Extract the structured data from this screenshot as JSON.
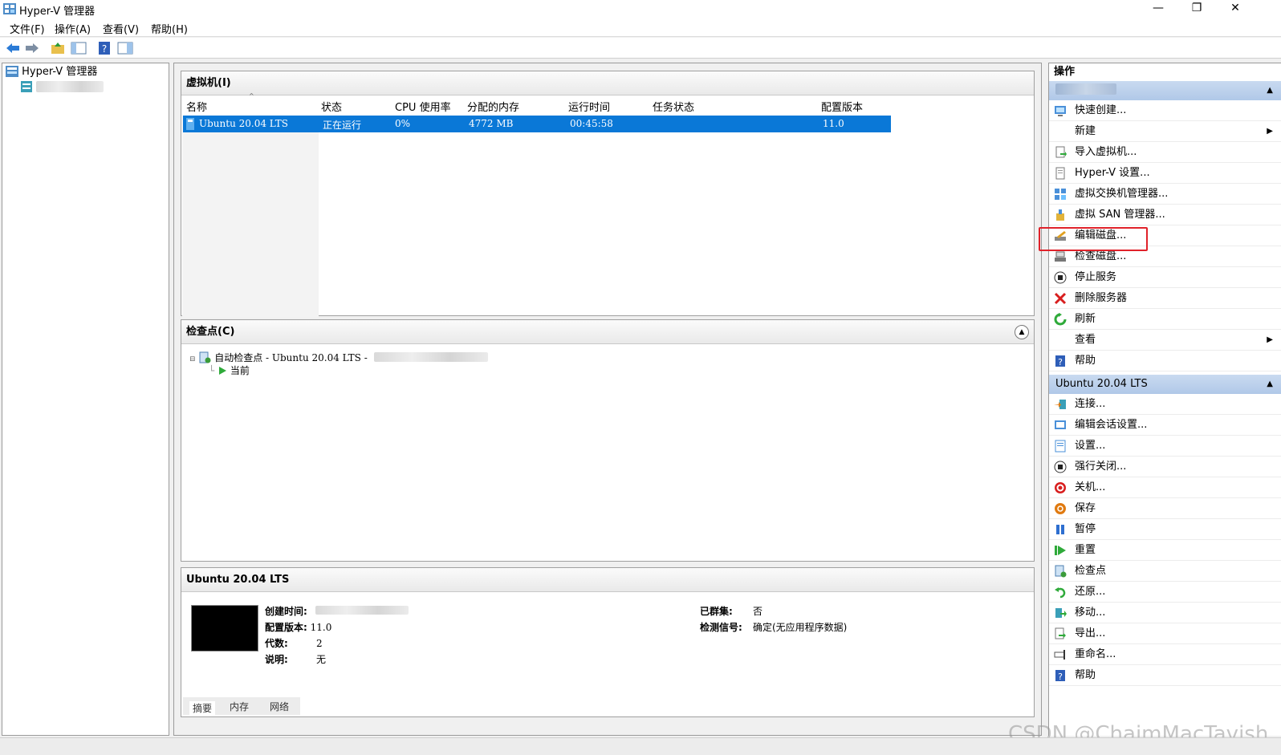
{
  "window": {
    "title": "Hyper-V 管理器",
    "minimize": "—",
    "restore": "❐",
    "close": "✕"
  },
  "menu": [
    "文件(F)",
    "操作(A)",
    "查看(V)",
    "帮助(H)"
  ],
  "tree": {
    "root": "Hyper-V 管理器"
  },
  "vm_panel": {
    "title": "虚拟机(I)",
    "columns": [
      "名称",
      "状态",
      "CPU 使用率",
      "分配的内存",
      "运行时间",
      "任务状态",
      "配置版本"
    ],
    "rows": [
      {
        "name": "Ubuntu 20.04 LTS",
        "state": "正在运行",
        "cpu": "0%",
        "memory": "4772 MB",
        "uptime": "00:45:58",
        "task": "",
        "version": "11.0"
      }
    ]
  },
  "checkpoint_panel": {
    "title": "检查点(C)",
    "checkpoint": "自动检查点 - Ubuntu 20.04 LTS -",
    "current": "当前"
  },
  "details_panel": {
    "title": "Ubuntu 20.04 LTS",
    "labels": {
      "created": "创建时间:",
      "config_version": "配置版本:",
      "generation": "代数:",
      "notes": "说明:",
      "clustered": "已群集:",
      "heartbeat": "检测信号:"
    },
    "values": {
      "config_version": "11.0",
      "generation": "2",
      "notes": "无",
      "clustered": "否",
      "heartbeat": "确定(无应用程序数据)"
    },
    "tabs": [
      "摘要",
      "内存",
      "网络"
    ]
  },
  "actions": {
    "title": "操作",
    "server_items": [
      {
        "label": "快速创建...",
        "icon": "quick-create-icon"
      },
      {
        "label": "新建",
        "icon": "new-icon",
        "submenu": true
      },
      {
        "label": "导入虚拟机...",
        "icon": "import-icon"
      },
      {
        "label": "Hyper-V 设置...",
        "icon": "settings-icon"
      },
      {
        "label": "虚拟交换机管理器...",
        "icon": "switch-icon"
      },
      {
        "label": "虚拟 SAN 管理器...",
        "icon": "san-icon"
      },
      {
        "label": "编辑磁盘...",
        "icon": "edit-disk-icon"
      },
      {
        "label": "检查磁盘...",
        "icon": "inspect-disk-icon"
      },
      {
        "label": "停止服务",
        "icon": "stop-service-icon"
      },
      {
        "label": "删除服务器",
        "icon": "delete-icon"
      },
      {
        "label": "刷新",
        "icon": "refresh-icon"
      },
      {
        "label": "查看",
        "icon": "view-icon",
        "submenu": true
      },
      {
        "label": "帮助",
        "icon": "help-icon"
      }
    ],
    "vm_group": "Ubuntu 20.04 LTS",
    "vm_items": [
      {
        "label": "连接...",
        "icon": "connect-icon"
      },
      {
        "label": "编辑会话设置...",
        "icon": "session-settings-icon"
      },
      {
        "label": "设置...",
        "icon": "vm-settings-icon"
      },
      {
        "label": "强行关闭...",
        "icon": "turn-off-icon"
      },
      {
        "label": "关机...",
        "icon": "shutdown-icon"
      },
      {
        "label": "保存",
        "icon": "save-icon"
      },
      {
        "label": "暂停",
        "icon": "pause-icon"
      },
      {
        "label": "重置",
        "icon": "reset-icon"
      },
      {
        "label": "检查点",
        "icon": "checkpoint-icon"
      },
      {
        "label": "还原...",
        "icon": "revert-icon"
      },
      {
        "label": "移动...",
        "icon": "move-icon"
      },
      {
        "label": "导出...",
        "icon": "export-icon"
      },
      {
        "label": "重命名...",
        "icon": "rename-icon"
      },
      {
        "label": "帮助",
        "icon": "help-icon"
      }
    ]
  },
  "watermark": "CSDN @ChaimMacTavish"
}
